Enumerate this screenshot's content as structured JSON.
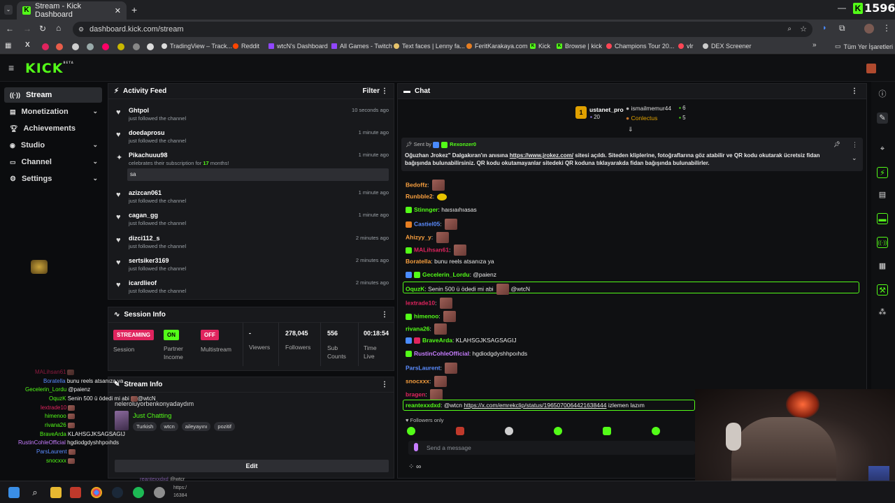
{
  "browser": {
    "tab_title": "Stream - Kick Dashboard",
    "url": "dashboard.kick.com/stream",
    "bookmarks": [
      "TradingView – Track...",
      "Reddit",
      "wtcN's Dashboard",
      "All Games - Twitch",
      "Text faces | Lenny fa...",
      "FeritKarakaya.com",
      "Kick",
      "Browse | kick",
      "Champions Tour 20...",
      "vlr",
      "DEX Screener"
    ],
    "all_bookmarks": "Tüm Yer İşaretleri",
    "viewer_overlay": "1596"
  },
  "kick": {
    "logo": "KICK",
    "logo_sup": "BETA"
  },
  "sidebar": {
    "items": [
      {
        "label": "Stream"
      },
      {
        "label": "Monetization"
      },
      {
        "label": "Achievements"
      },
      {
        "label": "Studio"
      },
      {
        "label": "Channel"
      },
      {
        "label": "Settings"
      }
    ]
  },
  "activity": {
    "title": "Activity Feed",
    "filter": "Filter",
    "items": [
      {
        "name": "Ghtpol",
        "sub": "just followed the channel",
        "time": "10 seconds ago"
      },
      {
        "name": "doedaprosu",
        "sub": "just followed the channel",
        "time": "1 minute ago"
      },
      {
        "name": "Pikachuuu98",
        "sub": "celebrates their subscription for ",
        "months": "17",
        "months_suffix": " months!",
        "time": "1 minute ago",
        "message": "sa"
      },
      {
        "name": "azizcan061",
        "sub": "just followed the channel",
        "time": "1 minute ago"
      },
      {
        "name": "cagan_gg",
        "sub": "just followed the channel",
        "time": "1 minute ago"
      },
      {
        "name": "dizci112_s",
        "sub": "just followed the channel",
        "time": "2 minutes ago"
      },
      {
        "name": "sertsiker3169",
        "sub": "just followed the channel",
        "time": "2 minutes ago"
      },
      {
        "name": "icardlieof",
        "sub": "just followed the channel",
        "time": "2 minutes ago"
      }
    ]
  },
  "session": {
    "title": "Session Info",
    "streaming": "STREAMING",
    "session_label": "Session",
    "on": "ON",
    "partner_income": "Partner Income",
    "off": "OFF",
    "multistream": "Multistream",
    "viewers_value": "-",
    "viewers_label": "Viewers",
    "followers_value": "278,045",
    "followers_label": "Followers",
    "subs_value": "556",
    "subs_label": "Sub Counts",
    "time_value": "00:18:54",
    "time_label": "Time Live"
  },
  "stream_info": {
    "title": "Stream Info",
    "stream_title": "neleroluyorbenkonyadaydım",
    "category": "Just Chatting",
    "tags": [
      "Turkish",
      "wtcn",
      "aileyayını",
      "pozitif"
    ],
    "edit": "Edit"
  },
  "chat": {
    "title": "Chat",
    "leaders": {
      "first": {
        "name": "ustanet_pro",
        "count": "20"
      },
      "second": {
        "name": "ismailmemur44",
        "count": "6"
      },
      "third": {
        "name": "Conlectus",
        "count": "5"
      }
    },
    "pinned": {
      "sent_by": "Sent by",
      "author": "Rexonzer0",
      "text_before": "Oğuzhan Jrokez\" Dalgakıran'ın anısına ",
      "link": "https://www.jrokez.com/",
      "text_after": " sitesi açıldı. Siteden kliplerine, fotoğraflarına göz atabilir ve QR kodu okutarak ücretsiz fidan bağışında bulunabilirsiniz. QR kodu okutamayanlar sitedeki QR koduna tıklayarakda fidan bağışında bulunabilirler."
    },
    "messages": [
      {
        "user": "Bedoffz",
        "text": "",
        "color": "#f9a03f"
      },
      {
        "user": "Runbble2",
        "text": "",
        "color": "#f9a03f"
      },
      {
        "user": "Stinnger",
        "text": "haısıaıhıasas",
        "color": "#53fc18"
      },
      {
        "user": "Castiel05",
        "text": "",
        "color": "#5b8cff"
      },
      {
        "user": "Ahizyy_y",
        "text": "",
        "color": "#f9a03f"
      },
      {
        "user": "MALihsan61",
        "text": "",
        "color": "#e0245e"
      },
      {
        "user": "Boratella",
        "text": "bunu reels atsanıza ya",
        "color": "#f9a03f"
      },
      {
        "user": "Gecelerin_Lordu",
        "text": "@paienz",
        "color": "#53fc18"
      },
      {
        "user": "OquzK",
        "text": "Senin 500 ü ödedi mi abi",
        "mention": "@wtcN",
        "color": "#f9a03f"
      },
      {
        "user": "lextrade10",
        "text": "",
        "color": "#e0245e"
      },
      {
        "user": "himenoo",
        "text": "",
        "color": "#53fc18"
      },
      {
        "user": "rivana26",
        "text": "",
        "color": "#53fc18"
      },
      {
        "user": "BraveArda",
        "text": "KLAHSGJKSAGSAGIJ",
        "color": "#53fc18"
      },
      {
        "user": "RustinCohleOfficial",
        "text": "hgdiodgdyshhpoıhds",
        "color": "#c77dff"
      },
      {
        "user": "ParsLaurent",
        "text": "",
        "color": "#5b8cff"
      },
      {
        "user": "snocxxx",
        "text": "",
        "color": "#f9a03f"
      },
      {
        "user": "bragen",
        "text": "",
        "color": "#e0245e"
      },
      {
        "user": "reantexxdxd",
        "text": "@wtcn",
        "link": "https://x.com/emrekclip/status/1965070064421638444",
        "after": " izlemen lazım",
        "color": "#53fc18"
      }
    ],
    "followers_only": "Followers only",
    "placeholder": "Send a message",
    "infinity": "∞"
  },
  "left_overlay": {
    "lines": [
      {
        "user": "MALihsan61",
        "text": ""
      },
      {
        "user": "Boratella",
        "text": "bunu reels atsanıza ya"
      },
      {
        "user": "Gecelerin_Lordu",
        "text": "@paienz"
      },
      {
        "user": "OquzK",
        "text": "Senin 500 ü ödedi mi abi",
        "mention": "@wtcN"
      },
      {
        "user": "lextrade10",
        "text": ""
      },
      {
        "user": "himenoo",
        "text": ""
      },
      {
        "user": "rivana26",
        "text": ""
      },
      {
        "user": "BraveArda",
        "text": "KLAHSGJKSAGSAGIJ"
      },
      {
        "user": "RustinCohleOfficial",
        "text": "hgdiodgdyshhpoıhds"
      },
      {
        "user": "ParsLaurent",
        "text": ""
      },
      {
        "user": "snocxxx",
        "text": ""
      }
    ],
    "bottom_user": "reantexxdxd",
    "bottom_mention": "@wtcr",
    "bottom_link": "https:/",
    "bottom_num": "16384"
  },
  "colors": {
    "accent": "#53fc18",
    "streaming": "#e0245e",
    "bg": "#0b0c0e",
    "panel": "#18191c"
  }
}
